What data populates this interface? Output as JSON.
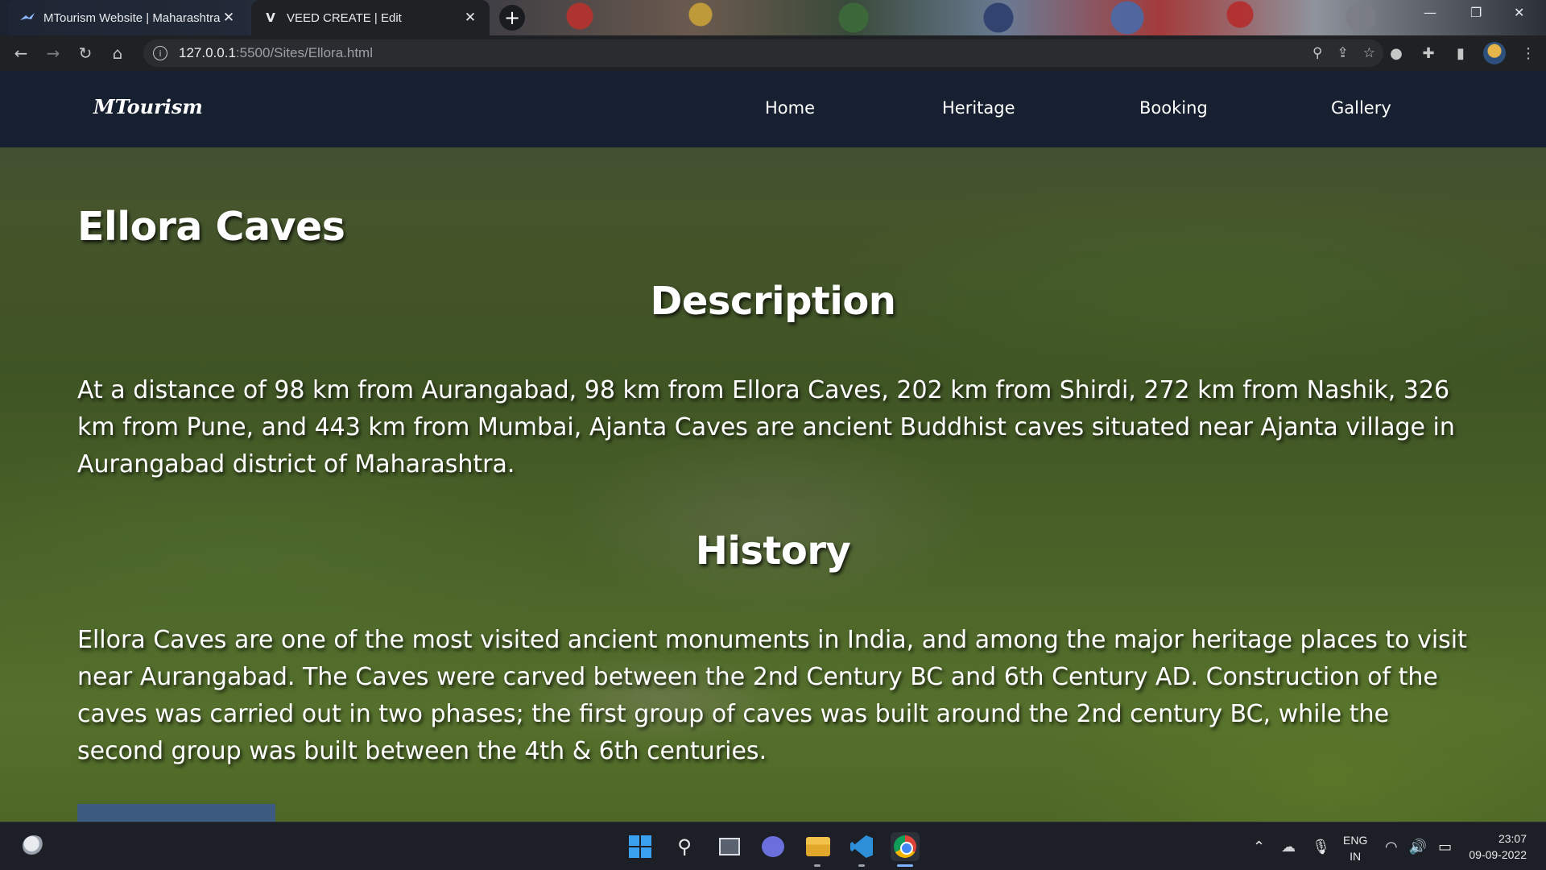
{
  "browser": {
    "tabs": [
      {
        "title": "MTourism Website | Maharashtra",
        "favicon": "mtourism-favicon"
      },
      {
        "title": "VEED CREATE | Edit",
        "favicon_letter": "V"
      }
    ],
    "url_host": "127.0.0.1",
    "url_path": ":5500/Sites/Ellora.html",
    "new_tab_symbol": "+",
    "close_symbol": "✕"
  },
  "site": {
    "brand": "MTourism",
    "nav": [
      {
        "label": "Home"
      },
      {
        "label": "Heritage"
      },
      {
        "label": "Booking"
      },
      {
        "label": "Gallery"
      }
    ]
  },
  "content": {
    "title": "Ellora Caves",
    "description_heading": "Description",
    "description": "At a distance of 98 km from Aurangabad, 98 km from Ellora Caves, 202 km from Shirdi, 272 km from Nashik, 326 km from Pune, and 443 km from Mumbai, Ajanta Caves are ancient Buddhist caves situated near Ajanta village in Aurangabad district of Maharashtra.",
    "history_heading": "History",
    "history": "Ellora Caves are one of the most visited ancient monuments in India, and among the major heritage places to visit near Aurangabad. The Caves were carved between the 2nd Century BC and 6th Century AD. Construction of the caves was carried out in two phases; the first group of caves was built around the 2nd century BC, while the second group was built between the 4th & 6th centuries."
  },
  "taskbar": {
    "language_line1": "ENG",
    "language_line2": "IN",
    "time": "23:07",
    "date": "09-09-2022"
  },
  "colors": {
    "navbar_bg": "#162030",
    "button_bg": "#3d5a80",
    "browser_bg": "#202124"
  }
}
